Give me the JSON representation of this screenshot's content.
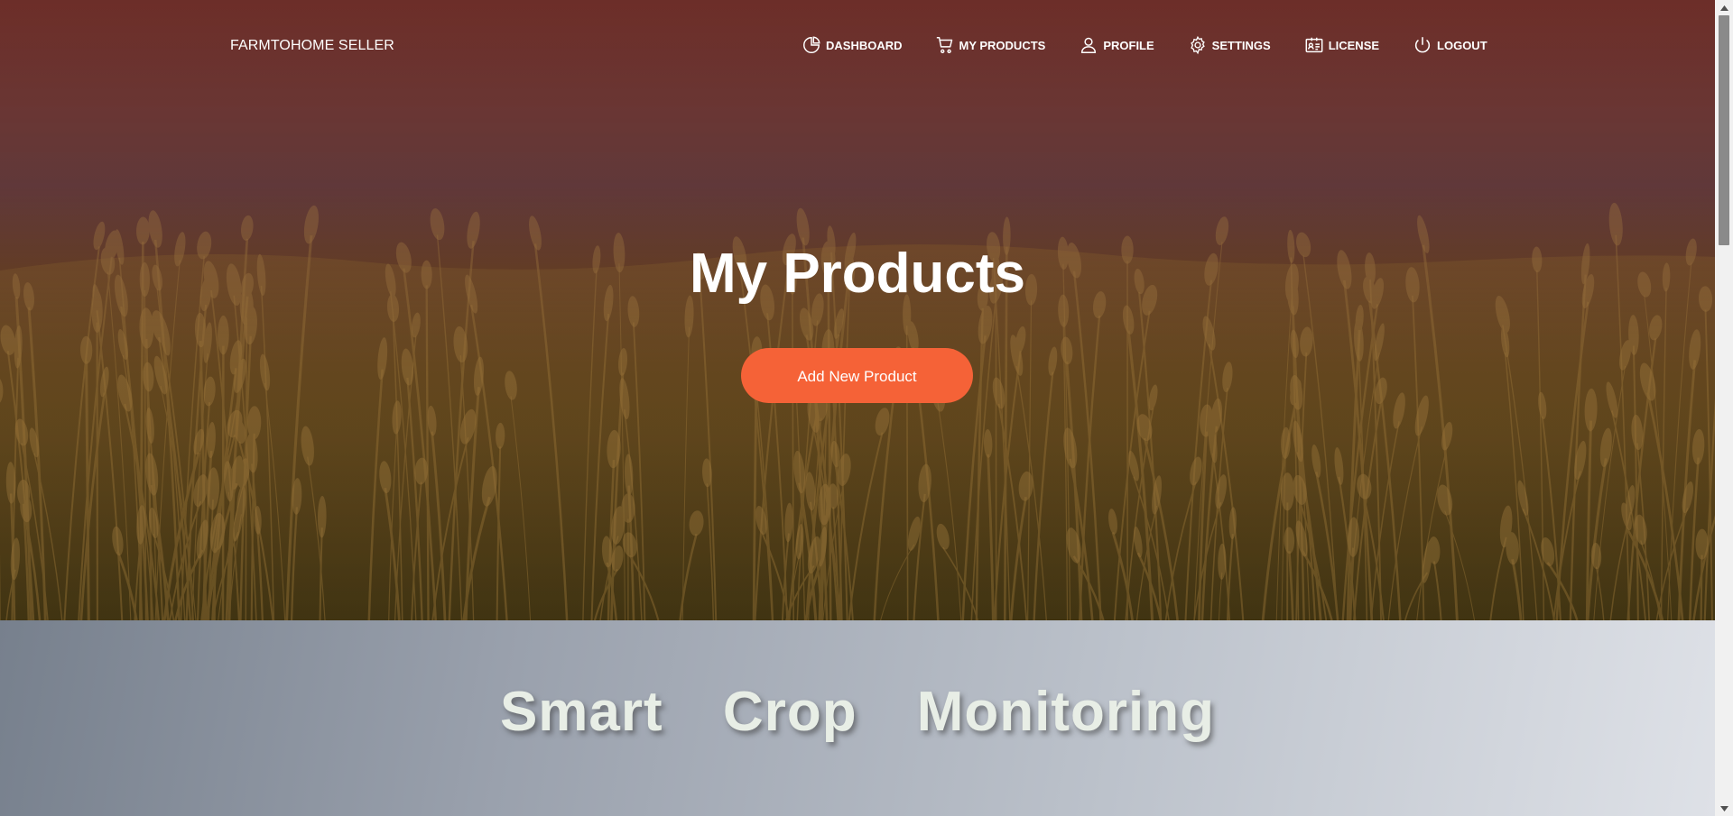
{
  "nav": {
    "brand": "FARMTOHOME SELLER",
    "items": [
      {
        "label": "DASHBOARD",
        "icon": "pie-chart-icon"
      },
      {
        "label": "MY PRODUCTS",
        "icon": "cart-icon"
      },
      {
        "label": "PROFILE",
        "icon": "user-icon"
      },
      {
        "label": "SETTINGS",
        "icon": "gear-icon"
      },
      {
        "label": "LICENSE",
        "icon": "id-card-icon"
      },
      {
        "label": "LOGOUT",
        "icon": "power-icon"
      }
    ]
  },
  "hero": {
    "title": "My Products",
    "cta_label": "Add New Product"
  },
  "section2": {
    "title": "Smart Crop Monitoring"
  },
  "colors": {
    "accent": "#f56237",
    "section2_text": "#e8eee6"
  }
}
